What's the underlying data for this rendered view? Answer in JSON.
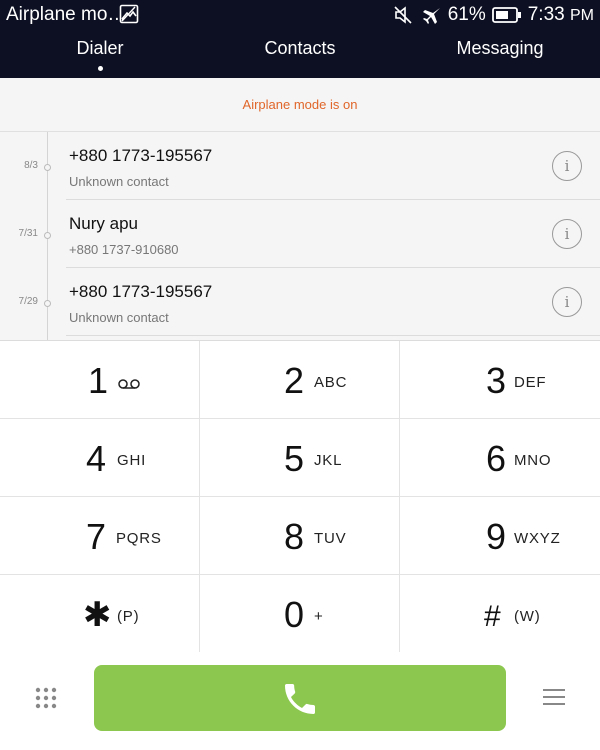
{
  "status_bar": {
    "title": "Airplane mo…",
    "battery_percent": "61%",
    "time": "7:33",
    "ampm": "PM",
    "icons": [
      "image-icon",
      "mute-icon",
      "airplane-icon",
      "battery-icon"
    ]
  },
  "tabs": [
    {
      "label": "Dialer",
      "active": true
    },
    {
      "label": "Contacts",
      "active": false
    },
    {
      "label": "Messaging",
      "active": false
    }
  ],
  "banner": {
    "text": "Airplane mode is on",
    "color": "#e0662a"
  },
  "call_log": [
    {
      "date": "8/3",
      "name": "+880 1773-195567",
      "sub": "Unknown contact"
    },
    {
      "date": "7/31",
      "name": "Nury apu",
      "sub": "+880 1737-910680"
    },
    {
      "date": "7/29",
      "name": "+880 1773-195567",
      "sub": "Unknown contact"
    }
  ],
  "keypad": [
    {
      "digit": "1",
      "letters": ""
    },
    {
      "digit": "2",
      "letters": "ABC"
    },
    {
      "digit": "3",
      "letters": "DEF"
    },
    {
      "digit": "4",
      "letters": "GHI"
    },
    {
      "digit": "5",
      "letters": "JKL"
    },
    {
      "digit": "6",
      "letters": "MNO"
    },
    {
      "digit": "7",
      "letters": "PQRS"
    },
    {
      "digit": "8",
      "letters": "TUV"
    },
    {
      "digit": "9",
      "letters": "WXYZ"
    },
    {
      "digit": "✱",
      "letters": "(P)"
    },
    {
      "digit": "0",
      "letters": "+"
    },
    {
      "digit": "#",
      "letters": "(W)"
    }
  ],
  "colors": {
    "call_button": "#8cc74f",
    "top_bar": "#0d1022"
  }
}
